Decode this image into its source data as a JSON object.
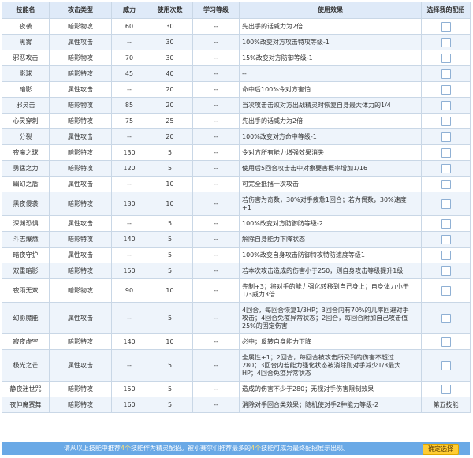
{
  "headers": {
    "name": "技能名",
    "type": "攻击类型",
    "power": "威力",
    "pp": "使用次数",
    "level": "学习等级",
    "effect": "使用效果",
    "select": "选择我的配招"
  },
  "rows": [
    {
      "name": "夜袭",
      "type": "暗影物攻",
      "power": "60",
      "pp": "30",
      "level": "--",
      "effect": [
        "先出手的话威力为2倍"
      ]
    },
    {
      "name": "黑雾",
      "type": "属性攻击",
      "power": "--",
      "pp": "30",
      "level": "--",
      "effect": [
        "100%改变对方攻击特攻等级-1"
      ]
    },
    {
      "name": "邪恶攻击",
      "type": "暗影物攻",
      "power": "70",
      "pp": "30",
      "level": "--",
      "effect": [
        "15%改变对方防御等级-1"
      ]
    },
    {
      "name": "影球",
      "type": "暗影特攻",
      "power": "45",
      "pp": "40",
      "level": "--",
      "effect": [
        "--"
      ]
    },
    {
      "name": "暗影",
      "type": "属性攻击",
      "power": "--",
      "pp": "20",
      "level": "--",
      "effect": [
        "命中后100%令对方害怕"
      ]
    },
    {
      "name": "邪灵击",
      "type": "暗影物攻",
      "power": "85",
      "pp": "20",
      "level": "--",
      "effect": [
        "当次攻击击败对方出战精灵时恢复自身最大体力的1/4"
      ]
    },
    {
      "name": "心灵穿刺",
      "type": "暗影特攻",
      "power": "75",
      "pp": "25",
      "level": "--",
      "effect": [
        "先出手的话威力为2倍"
      ]
    },
    {
      "name": "分裂",
      "type": "属性攻击",
      "power": "--",
      "pp": "20",
      "level": "--",
      "effect": [
        "100%改变对方命中等级-1"
      ]
    },
    {
      "name": "夜魔之球",
      "type": "暗影特攻",
      "power": "130",
      "pp": "5",
      "level": "--",
      "effect": [
        "令对方所有能力增强效果消失"
      ]
    },
    {
      "name": "勇猛之力",
      "type": "暗影特攻",
      "power": "120",
      "pp": "5",
      "level": "--",
      "effect": [
        "使用后5回合攻击击中对象要害概率增加1/16"
      ]
    },
    {
      "name": "幽幻之盾",
      "type": "属性攻击",
      "power": "--",
      "pp": "10",
      "level": "--",
      "effect": [
        "可完全抵挡一次攻击"
      ]
    },
    {
      "name": "黑夜侵袭",
      "type": "暗影特攻",
      "power": "130",
      "pp": "10",
      "level": "--",
      "effect": [
        "若伤害为奇数，30%对手疲惫1回合；若为偶数，30%速度",
        "+1"
      ]
    },
    {
      "name": "深渊恐惧",
      "type": "属性攻击",
      "power": "--",
      "pp": "5",
      "level": "--",
      "effect": [
        "100%改变对方防御防等级-2"
      ]
    },
    {
      "name": "斗志爆燃",
      "type": "暗影特攻",
      "power": "140",
      "pp": "5",
      "level": "--",
      "effect": [
        "解除自身能力下降状态"
      ]
    },
    {
      "name": "暗夜守护",
      "type": "属性攻击",
      "power": "--",
      "pp": "5",
      "level": "--",
      "effect": [
        "100%改变自身攻击防御特攻特防速度等级1"
      ]
    },
    {
      "name": "双重暗影",
      "type": "暗影特攻",
      "power": "150",
      "pp": "5",
      "level": "--",
      "effect": [
        "若本次攻击造成的伤害小于250，则自身攻击等级提升1级"
      ]
    },
    {
      "name": "夜雨无双",
      "type": "暗影物攻",
      "power": "90",
      "pp": "10",
      "level": "--",
      "effect": [
        "先制+3；将对手的能力强化转移到自己身上；自身体力小于",
        "1/3威力3倍"
      ]
    },
    {
      "name": "幻影魔能",
      "type": "属性攻击",
      "power": "--",
      "pp": "5",
      "level": "--",
      "effect": [
        "4回合，每回合恢复1/3HP；3回合内有70%的几率回避对手",
        "攻击；4回合免疫异常状态；2回合，每回合附加自己攻击值",
        "25%的固定伤害"
      ]
    },
    {
      "name": "寂夜虚空",
      "type": "暗影特攻",
      "power": "140",
      "pp": "10",
      "level": "--",
      "effect": [
        "必中；反转自身能力下降"
      ]
    },
    {
      "name": "极光之芒",
      "type": "属性攻击",
      "power": "--",
      "pp": "5",
      "level": "--",
      "effect": [
        "全属性+1；2回合，每回合被攻击所受到的伤害不超过",
        "280；3回合内若能力强化状态被消除则对手减少1/3最大",
        "HP；4回合免疫异常状态"
      ]
    },
    {
      "name": "静夜迷世咒",
      "type": "暗影特攻",
      "power": "150",
      "pp": "5",
      "level": "--",
      "effect": [
        "造成的伤害不少于280；无视对手伤害限制效果"
      ]
    },
    {
      "name": "夜伸魔赛舞",
      "type": "暗影特攻",
      "power": "160",
      "pp": "5",
      "level": "--",
      "effect": [
        "消除对手回合类效果；随机使对手2种能力等级-2"
      ],
      "select_text": "第五技能"
    }
  ],
  "footer": {
    "msg_1": "请从以上技能中推荐",
    "msg_2": "4个",
    "msg_3": "技能作为精灵配招。被小赛尔们推荐最多的",
    "msg_4": "4个",
    "msg_5": "技能可成为最终配招展示出现。",
    "button_label": "确定选择"
  },
  "colors": {
    "header_bg": "#dfeaf8",
    "row_alt_bg": "#eef4fb",
    "footer_bg": "#6aa9e6",
    "button_bg": "#ffcc33"
  }
}
